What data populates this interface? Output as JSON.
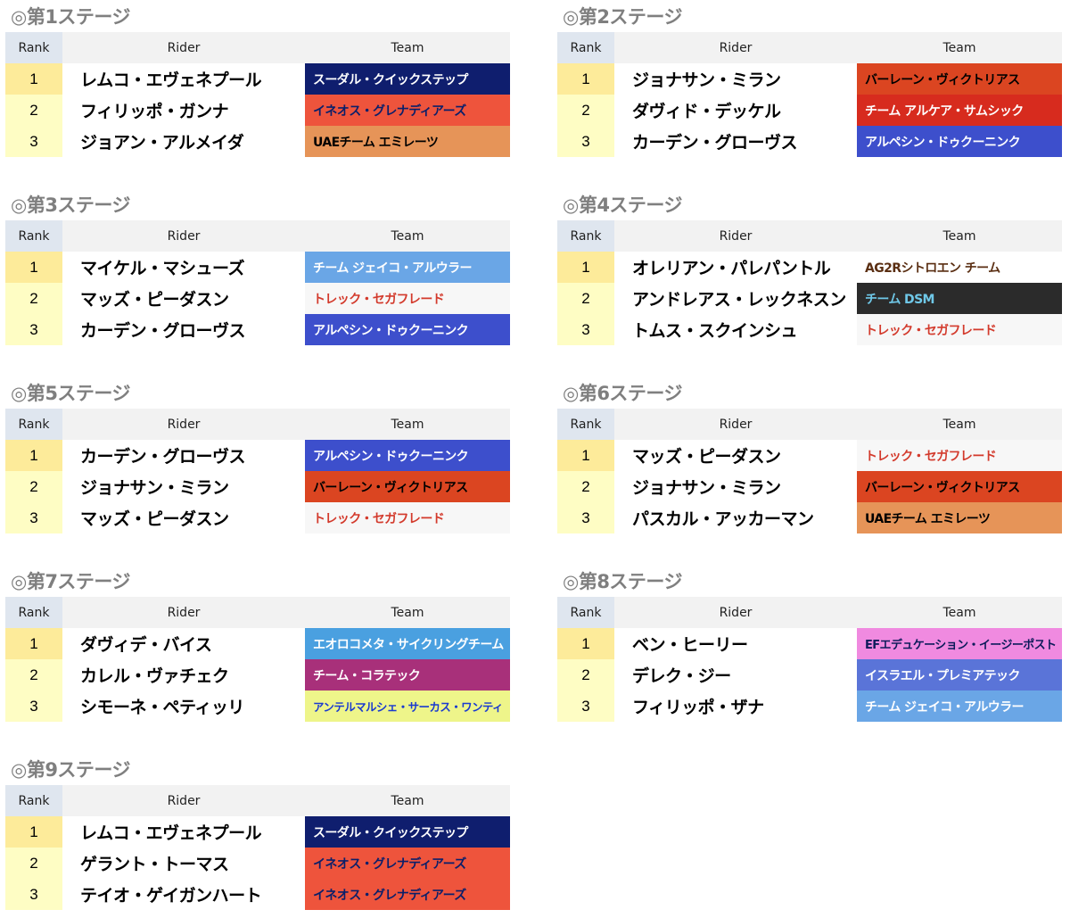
{
  "header_labels": {
    "rank": "Rank",
    "rider": "Rider",
    "team": "Team"
  },
  "stages": [
    {
      "title": "◎第1ステージ",
      "rows": [
        {
          "rank": "1",
          "rider": "レムコ・エヴェネプール",
          "team": "スーダル・クイックステップ",
          "team_bg": "#0f1e6e",
          "team_fg": "#ffffff"
        },
        {
          "rank": "2",
          "rider": "フィリッポ・ガンナ",
          "team": "イネオス・グレナディアーズ",
          "team_bg": "#ee543c",
          "team_fg": "#0a1f6a"
        },
        {
          "rank": "3",
          "rider": "ジョアン・アルメイダ",
          "team": "UAEチーム エミレーツ",
          "team_bg": "#e69458",
          "team_fg": "#000000"
        }
      ]
    },
    {
      "title": "◎第2ステージ",
      "rows": [
        {
          "rank": "1",
          "rider": "ジョナサン・ミラン",
          "team": "バーレーン・ヴィクトリアス",
          "team_bg": "#db4521",
          "team_fg": "#000000"
        },
        {
          "rank": "2",
          "rider": "ダヴィド・デッケル",
          "team": "チーム アルケア・サムシック",
          "team_bg": "#d72b1e",
          "team_fg": "#ffffff"
        },
        {
          "rank": "3",
          "rider": "カーデン・グローヴス",
          "team": "アルペシン・ドゥクーニンク",
          "team_bg": "#3d4fcc",
          "team_fg": "#ffffff"
        }
      ]
    },
    {
      "title": "◎第3ステージ",
      "rows": [
        {
          "rank": "1",
          "rider": "マイケル・マシューズ",
          "team": "チーム ジェイコ・アルウラー",
          "team_bg": "#6aa6e6",
          "team_fg": "#ffffff"
        },
        {
          "rank": "2",
          "rider": "マッズ・ピーダスン",
          "team": "トレック・セガフレード",
          "team_bg": "#f7f7f7",
          "team_fg": "#d33a2c"
        },
        {
          "rank": "3",
          "rider": "カーデン・グローヴス",
          "team": "アルペシン・ドゥクーニンク",
          "team_bg": "#3d4fcc",
          "team_fg": "#ffffff"
        }
      ]
    },
    {
      "title": "◎第4ステージ",
      "rows": [
        {
          "rank": "1",
          "rider": "オレリアン・パレパントル",
          "team": "AG2Rシトロエン チーム",
          "team_bg": "#ffffff",
          "team_fg": "#5a2e12"
        },
        {
          "rank": "2",
          "rider": "アンドレアス・レックネスン",
          "team": "チーム DSM",
          "team_bg": "#2b2b2b",
          "team_fg": "#6fc8e8"
        },
        {
          "rank": "3",
          "rider": "トムス・スクインシュ",
          "team": "トレック・セガフレード",
          "team_bg": "#f7f7f7",
          "team_fg": "#d33a2c"
        }
      ]
    },
    {
      "title": "◎第5ステージ",
      "rows": [
        {
          "rank": "1",
          "rider": "カーデン・グローヴス",
          "team": "アルペシン・ドゥクーニンク",
          "team_bg": "#3d4fcc",
          "team_fg": "#ffffff"
        },
        {
          "rank": "2",
          "rider": "ジョナサン・ミラン",
          "team": "バーレーン・ヴィクトリアス",
          "team_bg": "#db4521",
          "team_fg": "#000000"
        },
        {
          "rank": "3",
          "rider": "マッズ・ピーダスン",
          "team": "トレック・セガフレード",
          "team_bg": "#f7f7f7",
          "team_fg": "#d33a2c"
        }
      ]
    },
    {
      "title": "◎第6ステージ",
      "rows": [
        {
          "rank": "1",
          "rider": "マッズ・ピーダスン",
          "team": "トレック・セガフレード",
          "team_bg": "#f7f7f7",
          "team_fg": "#d33a2c"
        },
        {
          "rank": "2",
          "rider": "ジョナサン・ミラン",
          "team": "バーレーン・ヴィクトリアス",
          "team_bg": "#db4521",
          "team_fg": "#000000"
        },
        {
          "rank": "3",
          "rider": "パスカル・アッカーマン",
          "team": "UAEチーム エミレーツ",
          "team_bg": "#e69458",
          "team_fg": "#000000"
        }
      ]
    },
    {
      "title": "◎第7ステージ",
      "rows": [
        {
          "rank": "1",
          "rider": "ダヴィデ・バイス",
          "team": "エオロコメタ・サイクリングチーム",
          "team_bg": "#4aa0e0",
          "team_fg": "#ffffff"
        },
        {
          "rank": "2",
          "rider": "カレル・ヴァチェク",
          "team": "チーム・コラテック",
          "team_bg": "#a8307a",
          "team_fg": "#ffffff"
        },
        {
          "rank": "3",
          "rider": "シモーネ・ペティッリ",
          "team": "アンテルマルシェ・サーカス・ワンティ",
          "team_bg": "#eef58a",
          "team_fg": "#1a3ad0"
        }
      ]
    },
    {
      "title": "◎第8ステージ",
      "rows": [
        {
          "rank": "1",
          "rider": "ベン・ヒーリー",
          "team": "EFエデュケーション・イージーポスト",
          "team_bg": "#f08ae0",
          "team_fg": "#0c1b5a"
        },
        {
          "rank": "2",
          "rider": "デレク・ジー",
          "team": "イスラエル・プレミアテック",
          "team_bg": "#5a74d8",
          "team_fg": "#ffffff"
        },
        {
          "rank": "3",
          "rider": "フィリッポ・ザナ",
          "team": "チーム ジェイコ・アルウラー",
          "team_bg": "#6aa6e6",
          "team_fg": "#ffffff"
        }
      ]
    },
    {
      "title": "◎第9ステージ",
      "rows": [
        {
          "rank": "1",
          "rider": "レムコ・エヴェネプール",
          "team": "スーダル・クイックステップ",
          "team_bg": "#0f1e6e",
          "team_fg": "#ffffff"
        },
        {
          "rank": "2",
          "rider": "ゲラント・トーマス",
          "team": "イネオス・グレナディアーズ",
          "team_bg": "#ee543c",
          "team_fg": "#0a1f6a"
        },
        {
          "rank": "3",
          "rider": "テイオ・ゲイガンハート",
          "team": "イネオス・グレナディアーズ",
          "team_bg": "#ee543c",
          "team_fg": "#0a1f6a"
        }
      ]
    }
  ]
}
